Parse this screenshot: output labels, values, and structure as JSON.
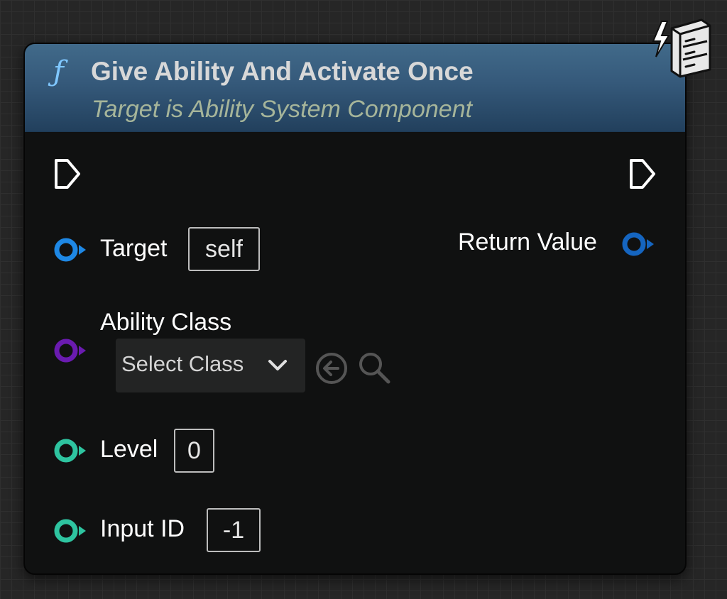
{
  "node": {
    "icon": "function-icon",
    "icon_glyph": "ƒ",
    "title": "Give Ability And Activate Once",
    "subtitle": "Target is Ability System Component",
    "header_color": "#35597a"
  },
  "pins": {
    "target": {
      "label": "Target",
      "value": "self",
      "color": "#1e88e5"
    },
    "return_value": {
      "label": "Return Value",
      "color": "#1565c0"
    },
    "ability_class": {
      "label": "Ability Class",
      "color": "#6a1bb0",
      "select_placeholder": "Select Class"
    },
    "level": {
      "label": "Level",
      "value": "0",
      "color": "#2ec4a0"
    },
    "input_id": {
      "label": "Input ID",
      "value": "-1",
      "color": "#2ec4a0"
    }
  },
  "icons": {
    "exec_in": "exec-in-pin-icon",
    "exec_out": "exec-out-pin-icon",
    "use_selected": "arrow-left-circle-icon",
    "browse": "search-icon",
    "corner": "latent-server-icon"
  }
}
